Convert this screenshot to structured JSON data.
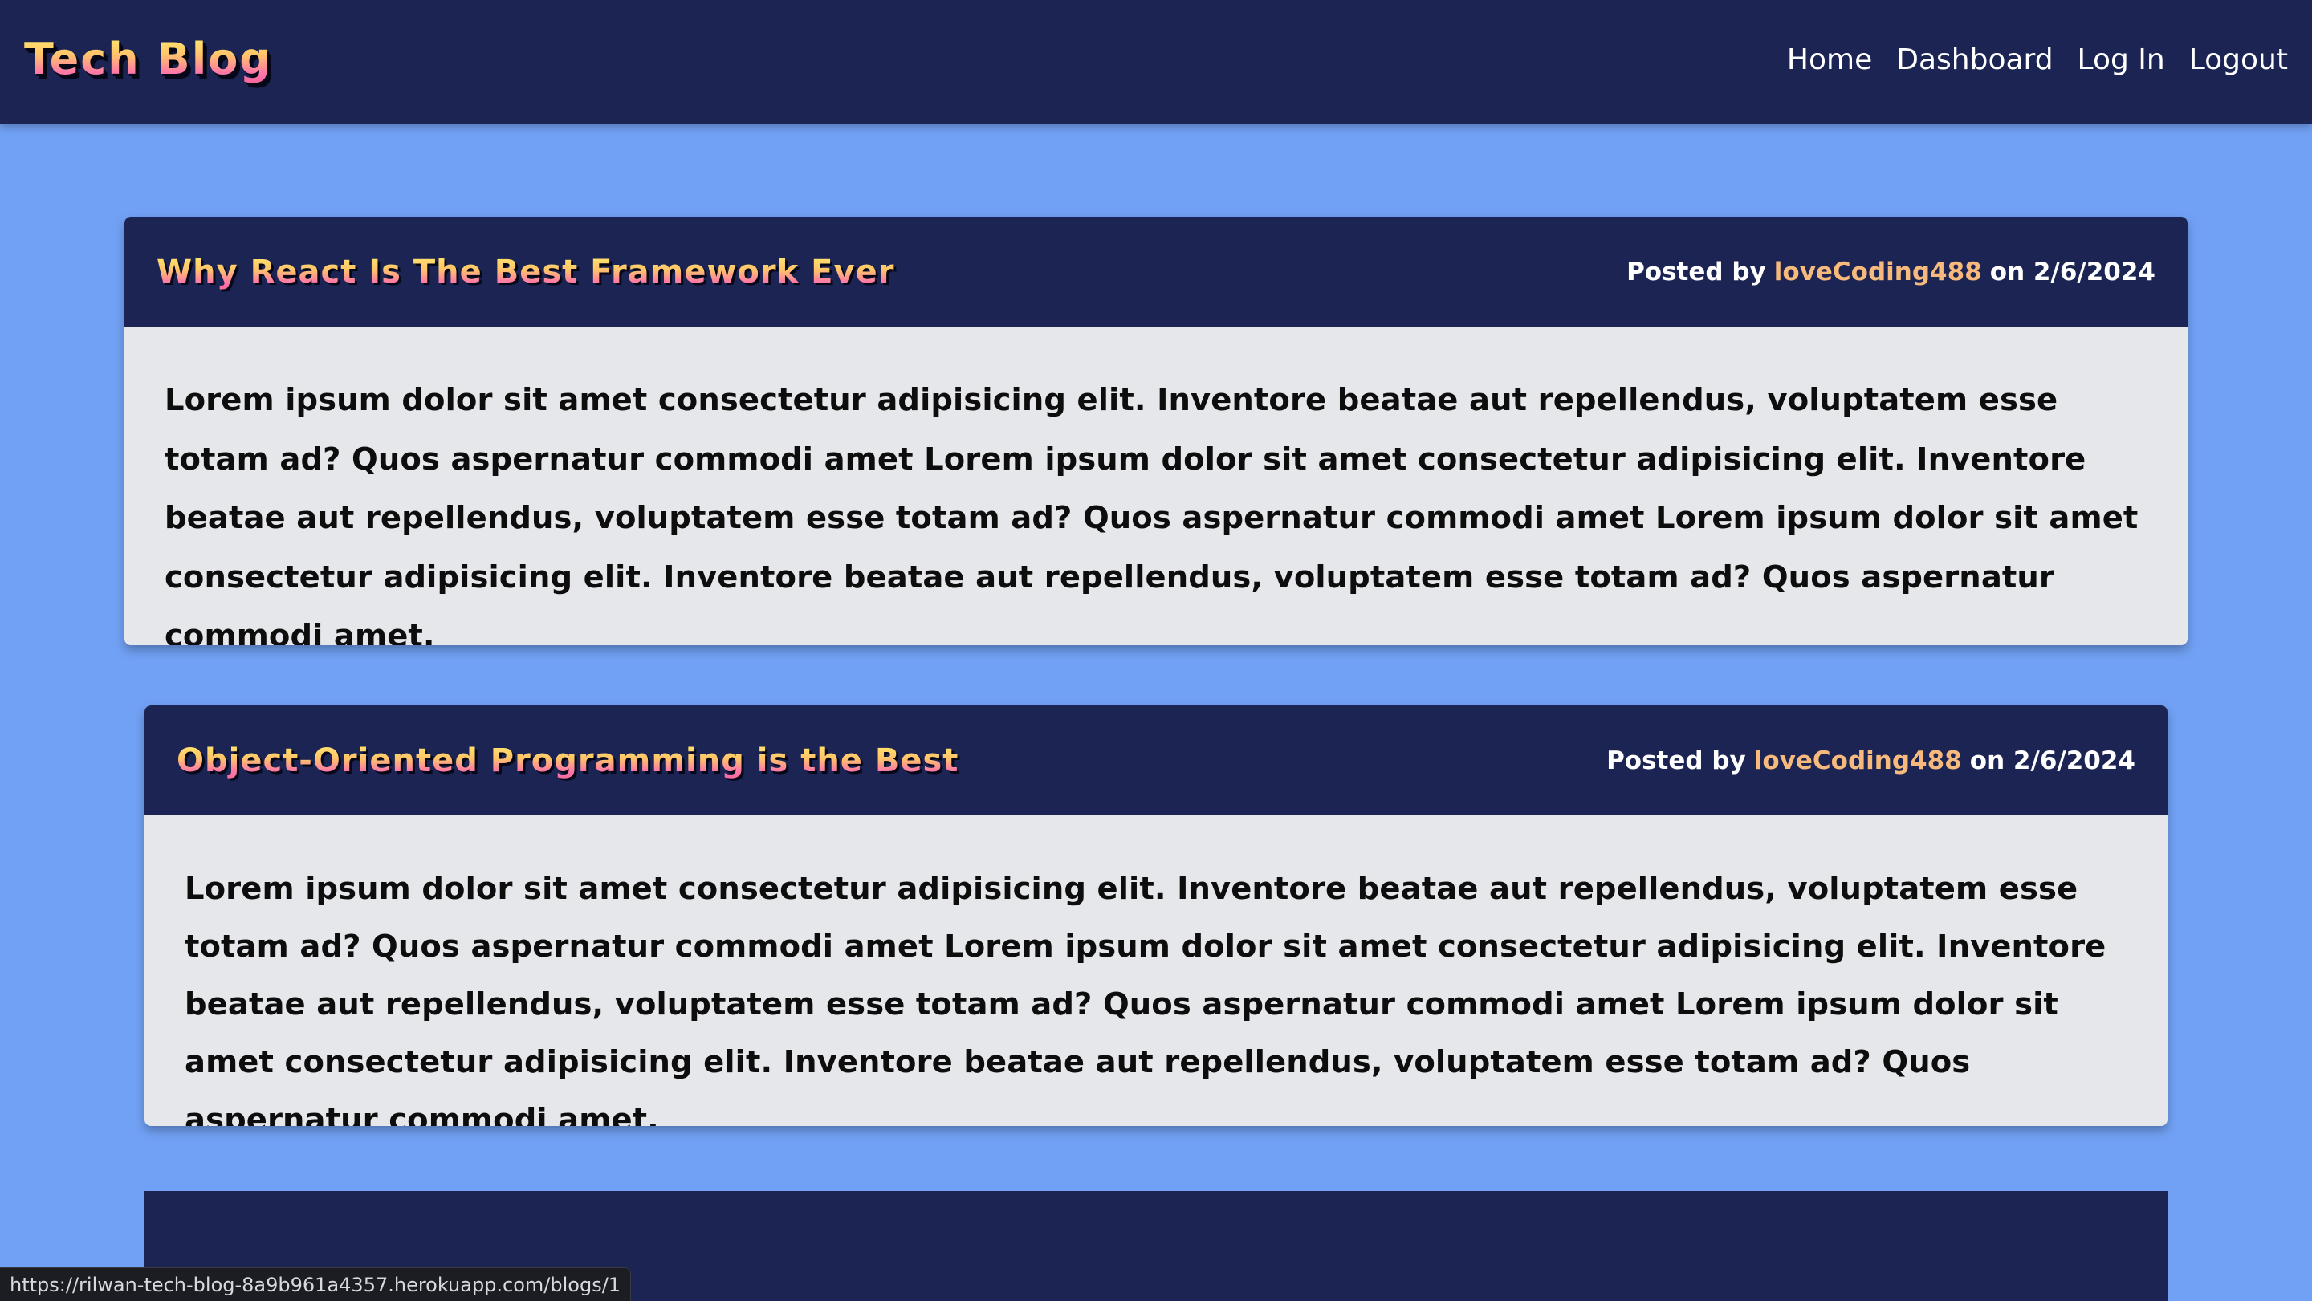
{
  "header": {
    "brand": "Tech Blog",
    "nav": [
      "Home",
      "Dashboard",
      "Log In",
      "Logout"
    ]
  },
  "posts": [
    {
      "title": "Why React Is The Best Framework Ever",
      "posted_by_label": "Posted by",
      "author": "loveCoding488",
      "date": "on 2/6/2024",
      "body": "Lorem ipsum dolor sit amet consectetur adipisicing elit. Inventore beatae aut repellendus, voluptatem esse totam ad? Quos aspernatur commodi amet Lorem ipsum dolor sit amet consectetur adipisicing elit. Inventore beatae aut repellendus, voluptatem esse totam ad? Quos aspernatur commodi amet Lorem ipsum dolor sit amet consectetur adipisicing elit. Inventore beatae aut repellendus, voluptatem esse totam ad? Quos aspernatur commodi amet."
    },
    {
      "title": "Object-Oriented Programming is the Best",
      "posted_by_label": "Posted by",
      "author": "loveCoding488",
      "date": "on 2/6/2024",
      "body": "Lorem ipsum dolor sit amet consectetur adipisicing elit. Inventore beatae aut repellendus, voluptatem esse totam ad? Quos aspernatur commodi amet Lorem ipsum dolor sit amet consectetur adipisicing elit. Inventore beatae aut repellendus, voluptatem esse totam ad? Quos aspernatur commodi amet Lorem ipsum dolor sit amet consectetur adipisicing elit. Inventore beatae aut repellendus, voluptatem esse totam ad? Quos aspernatur commodi amet."
    }
  ],
  "status_bar": {
    "url": "https://rilwan-tech-blog-8a9b961a4357.herokuapp.com/blogs/1"
  },
  "colors": {
    "page_bg": "#71a1f4",
    "header_bg": "#1b2453",
    "card_bg": "#e6e7eb",
    "author_color": "#f7ba7c"
  }
}
